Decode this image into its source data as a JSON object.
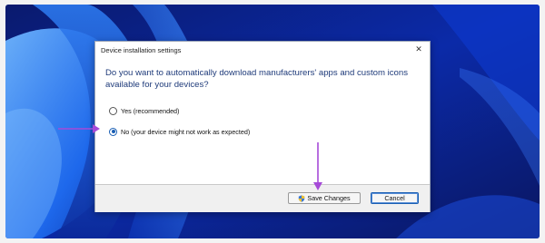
{
  "dialog": {
    "title": "Device installation settings",
    "close_glyph": "✕",
    "question": "Do you want to automatically download manufacturers' apps and custom icons available for your devices?",
    "options": [
      {
        "label": "Yes (recommended)",
        "selected": false
      },
      {
        "label": "No (your device might not work as expected)",
        "selected": true
      }
    ],
    "buttons": {
      "save": {
        "label": "Save Changes",
        "icon": "uac-shield-icon"
      },
      "cancel": {
        "label": "Cancel"
      }
    }
  },
  "annotations": {
    "arrow_color": "#a64ad8"
  },
  "colors": {
    "accent": "#1a5fb4",
    "question_text": "#1f3b7a"
  }
}
